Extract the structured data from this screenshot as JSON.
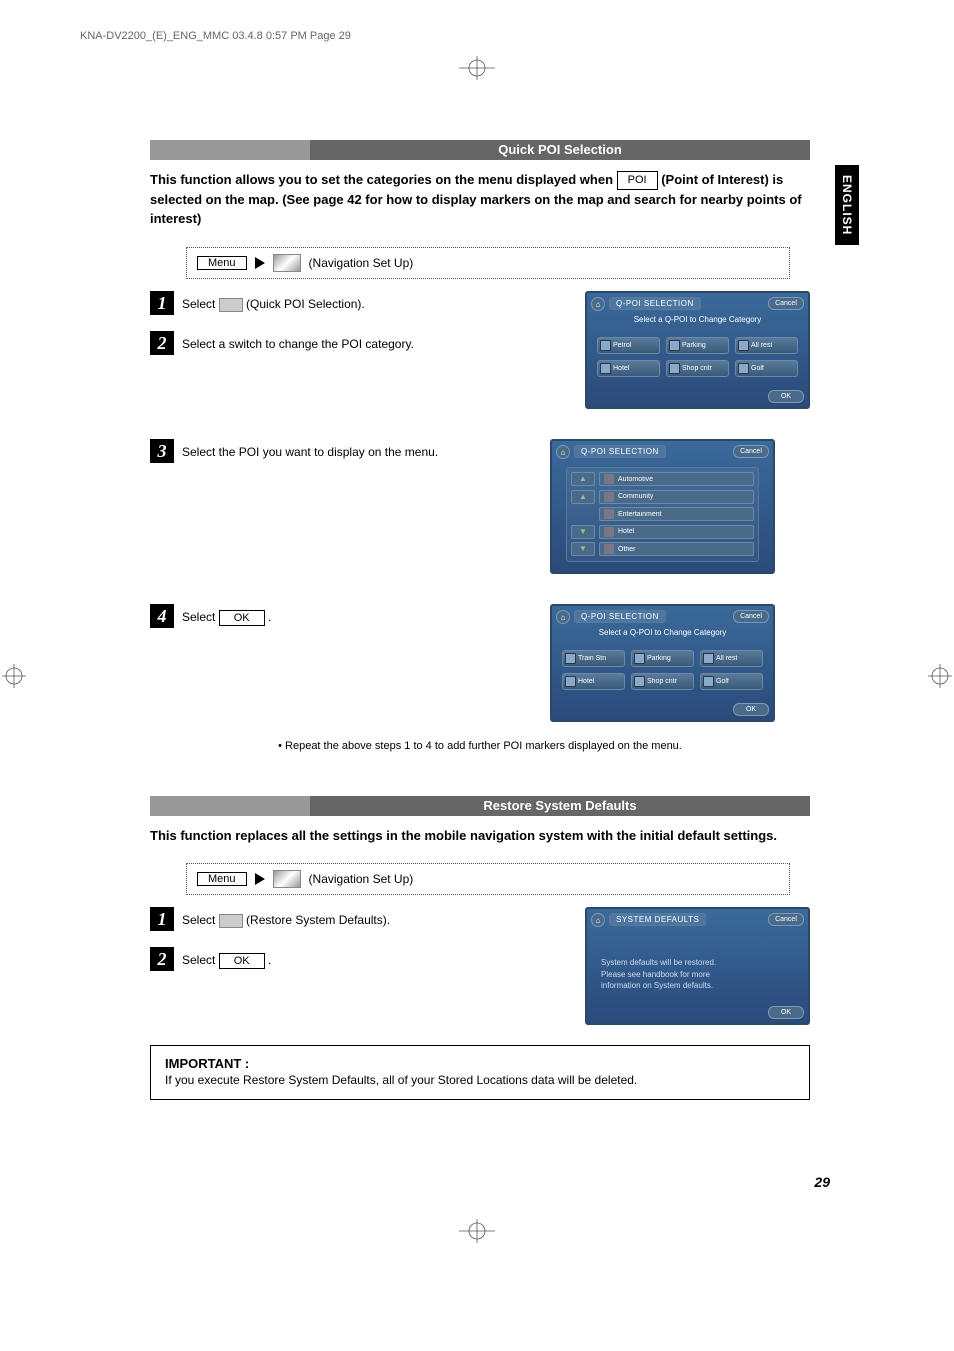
{
  "header_line": "KNA-DV2200_(E)_ENG_MMC  03.4.8  0:57 PM  Page 29",
  "english_tab": "ENGLISH",
  "page_number": "29",
  "sec1": {
    "title": "Quick POI Selection",
    "intro_1": "This function allows you to set the categories on the menu displayed when",
    "poi_label": "POI",
    "intro_2": "(Point of Interest) is selected on the map. (See page 42 for how to display markers on the map and search for nearby points of interest)",
    "menu_label": "Menu",
    "nav_label": "(Navigation Set Up)",
    "step1": {
      "pre": "Select",
      "post": "(Quick POI Selection)."
    },
    "step2": "Select a switch to change the POI category.",
    "step3": "Select the POI you want to display on the menu.",
    "step4": {
      "pre": "Select",
      "btn": "OK",
      "post": "."
    },
    "note": "• Repeat the above steps 1 to 4 to add further POI markers displayed on the menu.",
    "screen1": {
      "title": "Q-POI SELECTION",
      "cancel": "Cancel",
      "sub": "Select a Q-POI to Change Category",
      "ok": "OK",
      "buttons": [
        "Petrol",
        "Parking",
        "All rest",
        "Hotel",
        "Shop cntr",
        "Golf"
      ]
    },
    "screen2": {
      "title": "Q-POI SELECTION",
      "cancel": "Cancel",
      "items": [
        "Automotive",
        "Community",
        "Entertainment",
        "Hotel",
        "Other"
      ]
    },
    "screen3": {
      "title": "Q-POI SELECTION",
      "cancel": "Cancel",
      "sub": "Select a Q-POI to Change Category",
      "ok": "OK",
      "buttons": [
        "Train Stn",
        "Parking",
        "All rest",
        "Hotel",
        "Shop cntr",
        "Golf"
      ]
    }
  },
  "sec2": {
    "title": "Restore System Defaults",
    "intro": "This function replaces all the settings in the mobile navigation system with the initial default settings.",
    "menu_label": "Menu",
    "nav_label": "(Navigation Set Up)",
    "step1": {
      "pre": "Select",
      "post": "(Restore System Defaults)."
    },
    "step2": {
      "pre": "Select",
      "btn": "OK",
      "post": "."
    },
    "screen": {
      "title": "SYSTEM DEFAULTS",
      "cancel": "Cancel",
      "msg1": "System defaults will be restored.",
      "msg2": "Please see handbook for more",
      "msg3": "information on System defaults.",
      "ok": "OK"
    },
    "important_title": "IMPORTANT :",
    "important_text": "If you execute Restore System Defaults, all of your Stored Locations data will be deleted."
  }
}
